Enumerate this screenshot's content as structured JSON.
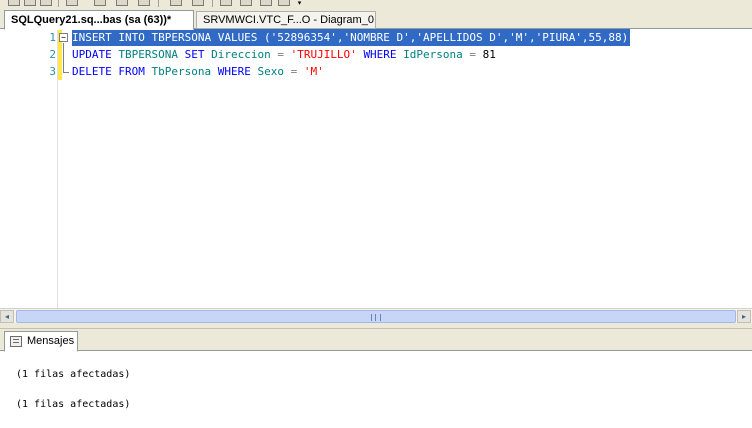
{
  "tabs": [
    {
      "label": "SQLQuery21.sq...bas (sa (63))*",
      "active": true
    },
    {
      "label": "SRVMWCI.VTC_F...O - Diagram_0",
      "active": false
    }
  ],
  "editor": {
    "line_numbers": [
      "1",
      "2",
      "3"
    ],
    "outline_glyph": "−",
    "lines": [
      {
        "selected": true,
        "tokens": [
          {
            "t": "INSERT INTO TBPERSONA VALUES ('52896354','NOMBRE D','APELLIDOS D','M','PIURA',55,88)",
            "c": "plain"
          }
        ]
      },
      {
        "selected": false,
        "tokens": [
          {
            "t": "UPDATE ",
            "c": "kw"
          },
          {
            "t": "TBPERSONA ",
            "c": "obj"
          },
          {
            "t": "SET ",
            "c": "kw"
          },
          {
            "t": "Direccion ",
            "c": "obj"
          },
          {
            "t": "= ",
            "c": "op"
          },
          {
            "t": "'TRUJILLO' ",
            "c": "str"
          },
          {
            "t": "WHERE ",
            "c": "kw"
          },
          {
            "t": "IdPersona ",
            "c": "obj"
          },
          {
            "t": "= ",
            "c": "op"
          },
          {
            "t": "81",
            "c": "num"
          }
        ]
      },
      {
        "selected": false,
        "tokens": [
          {
            "t": "DELETE ",
            "c": "kw"
          },
          {
            "t": "FROM ",
            "c": "kw"
          },
          {
            "t": "TbPersona ",
            "c": "obj"
          },
          {
            "t": "WHERE ",
            "c": "kw"
          },
          {
            "t": "Sexo ",
            "c": "obj"
          },
          {
            "t": "= ",
            "c": "op"
          },
          {
            "t": "'M'",
            "c": "str"
          }
        ]
      }
    ]
  },
  "results": {
    "tab_label": "Mensajes",
    "messages": [
      "(1 filas afectadas)",
      "(1 filas afectadas)"
    ]
  },
  "colors": {
    "selection": "#316ac5",
    "keyword": "#0000ff",
    "string": "#ff0000",
    "object": "#008080",
    "operator": "#808080",
    "line_number": "#2b91af",
    "change_marker": "#ffe74a"
  },
  "icons": {
    "more": "▾",
    "scroll_left": "◂",
    "scroll_right": "▸"
  }
}
